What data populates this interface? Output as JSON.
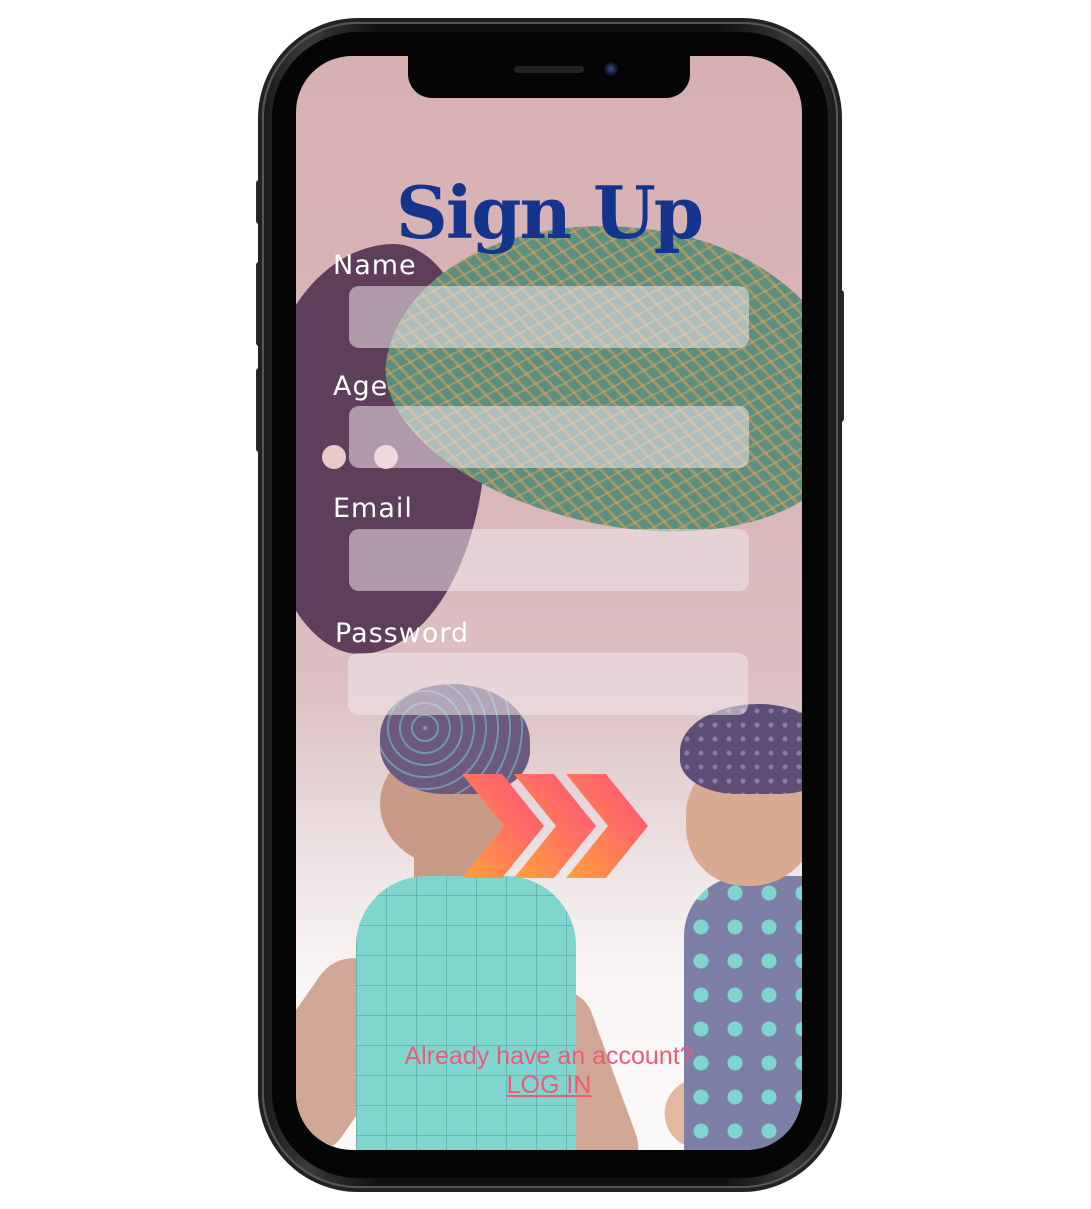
{
  "title": "Sign Up",
  "fields": {
    "name": {
      "label": "Name",
      "value": "",
      "placeholder": ""
    },
    "age": {
      "label": "Age",
      "value": "",
      "placeholder": ""
    },
    "email": {
      "label": "Email",
      "value": "",
      "placeholder": ""
    },
    "password": {
      "label": "Password",
      "value": "",
      "placeholder": ""
    }
  },
  "submit": {
    "icon": "triple-chevron-right-icon"
  },
  "footer": {
    "account_prompt": "Already have an account?",
    "login_label": "LOG IN"
  },
  "colors": {
    "title": "#15358c",
    "accent": "#ee5a7a",
    "arrow_start": "#ffa23a",
    "arrow_end": "#ff4f78"
  }
}
